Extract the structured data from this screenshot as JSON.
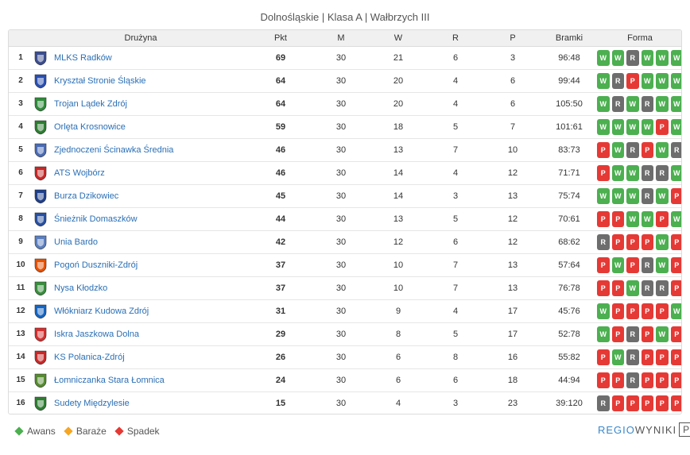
{
  "title": "Dolnośląskie | Klasa A | Wałbrzych III",
  "headers": {
    "team": "Drużyna",
    "pts": "Pkt",
    "m": "M",
    "w": "W",
    "r": "R",
    "p": "P",
    "goals": "Bramki",
    "form": "Forma"
  },
  "rows": [
    {
      "pos": "1",
      "team": "MLKS Radków",
      "pts": "69",
      "m": "30",
      "w": "21",
      "r": "6",
      "p": "3",
      "goals": "96:48",
      "crest_color": "#3b4d8f",
      "form": [
        "W",
        "W",
        "R",
        "W",
        "W",
        "W"
      ]
    },
    {
      "pos": "2",
      "team": "Kryształ Stronie Śląskie",
      "pts": "64",
      "m": "30",
      "w": "20",
      "r": "4",
      "p": "6",
      "goals": "99:44",
      "crest_color": "#2a4fb0",
      "form": [
        "W",
        "R",
        "P",
        "W",
        "W",
        "W"
      ]
    },
    {
      "pos": "3",
      "team": "Trojan Lądek Zdrój",
      "pts": "64",
      "m": "30",
      "w": "20",
      "r": "4",
      "p": "6",
      "goals": "105:50",
      "crest_color": "#2e8b3a",
      "form": [
        "W",
        "R",
        "W",
        "R",
        "W",
        "W"
      ]
    },
    {
      "pos": "4",
      "team": "Orlęta Krosnowice",
      "pts": "59",
      "m": "30",
      "w": "18",
      "r": "5",
      "p": "7",
      "goals": "101:61",
      "crest_color": "#2e7d32",
      "form": [
        "W",
        "W",
        "W",
        "W",
        "P",
        "W"
      ]
    },
    {
      "pos": "5",
      "team": "Zjednoczeni Ścinawka Średnia",
      "pts": "46",
      "m": "30",
      "w": "13",
      "r": "7",
      "p": "10",
      "goals": "83:73",
      "crest_color": "#4a6bb5",
      "form": [
        "P",
        "W",
        "R",
        "P",
        "W",
        "R"
      ]
    },
    {
      "pos": "6",
      "team": "ATS Wojbórz",
      "pts": "46",
      "m": "30",
      "w": "14",
      "r": "4",
      "p": "12",
      "goals": "71:71",
      "crest_color": "#c62828",
      "form": [
        "P",
        "W",
        "W",
        "R",
        "R",
        "W"
      ]
    },
    {
      "pos": "7",
      "team": "Burza Dzikowiec",
      "pts": "45",
      "m": "30",
      "w": "14",
      "r": "3",
      "p": "13",
      "goals": "75:74",
      "crest_color": "#1e3f8a",
      "form": [
        "W",
        "W",
        "W",
        "R",
        "W",
        "P"
      ]
    },
    {
      "pos": "8",
      "team": "Śnieżnik Domaszków",
      "pts": "44",
      "m": "30",
      "w": "13",
      "r": "5",
      "p": "12",
      "goals": "70:61",
      "crest_color": "#2850a0",
      "form": [
        "P",
        "P",
        "W",
        "W",
        "P",
        "W"
      ]
    },
    {
      "pos": "9",
      "team": "Unia Bardo",
      "pts": "42",
      "m": "30",
      "w": "12",
      "r": "6",
      "p": "12",
      "goals": "68:62",
      "crest_color": "#5b7fbf",
      "form": [
        "R",
        "P",
        "P",
        "P",
        "W",
        "P"
      ]
    },
    {
      "pos": "10",
      "team": "Pogoń Duszniki-Zdrój",
      "pts": "37",
      "m": "30",
      "w": "10",
      "r": "7",
      "p": "13",
      "goals": "57:64",
      "crest_color": "#e65100",
      "form": [
        "P",
        "W",
        "P",
        "R",
        "W",
        "P"
      ]
    },
    {
      "pos": "11",
      "team": "Nysa Kłodzko",
      "pts": "37",
      "m": "30",
      "w": "10",
      "r": "7",
      "p": "13",
      "goals": "76:78",
      "crest_color": "#388e3c",
      "form": [
        "P",
        "P",
        "W",
        "R",
        "R",
        "P"
      ]
    },
    {
      "pos": "12",
      "team": "Włókniarz Kudowa Zdrój",
      "pts": "31",
      "m": "30",
      "w": "9",
      "r": "4",
      "p": "17",
      "goals": "45:76",
      "crest_color": "#1565c0",
      "form": [
        "W",
        "P",
        "P",
        "P",
        "P",
        "W"
      ]
    },
    {
      "pos": "13",
      "team": "Iskra Jaszkowa Dolna",
      "pts": "29",
      "m": "30",
      "w": "8",
      "r": "5",
      "p": "17",
      "goals": "52:78",
      "crest_color": "#d32f2f",
      "form": [
        "W",
        "P",
        "R",
        "P",
        "W",
        "P"
      ]
    },
    {
      "pos": "14",
      "team": "KS Polanica-Zdrój",
      "pts": "26",
      "m": "30",
      "w": "6",
      "r": "8",
      "p": "16",
      "goals": "55:82",
      "crest_color": "#c62828",
      "form": [
        "P",
        "W",
        "R",
        "P",
        "P",
        "P"
      ]
    },
    {
      "pos": "15",
      "team": "Łomniczanka Stara Łomnica",
      "pts": "24",
      "m": "30",
      "w": "6",
      "r": "6",
      "p": "18",
      "goals": "44:94",
      "crest_color": "#558b2f",
      "form": [
        "P",
        "P",
        "R",
        "P",
        "P",
        "P"
      ]
    },
    {
      "pos": "16",
      "team": "Sudety Międzylesie",
      "pts": "15",
      "m": "30",
      "w": "4",
      "r": "3",
      "p": "23",
      "goals": "39:120",
      "crest_color": "#2e7d32",
      "form": [
        "R",
        "P",
        "P",
        "P",
        "P",
        "P"
      ]
    }
  ],
  "legend": [
    {
      "label": "Awans",
      "color": "#4caf50"
    },
    {
      "label": "Baraże",
      "color": "#f5a623"
    },
    {
      "label": "Spadek",
      "color": "#e53935"
    }
  ],
  "brand": {
    "part1": "REGIO",
    "part2": "WYNIKI",
    "part3": "PL"
  },
  "colors": {
    "win": "#4caf50",
    "draw": "#6d6d6d",
    "loss": "#e53935",
    "link": "#2a6fb5"
  }
}
